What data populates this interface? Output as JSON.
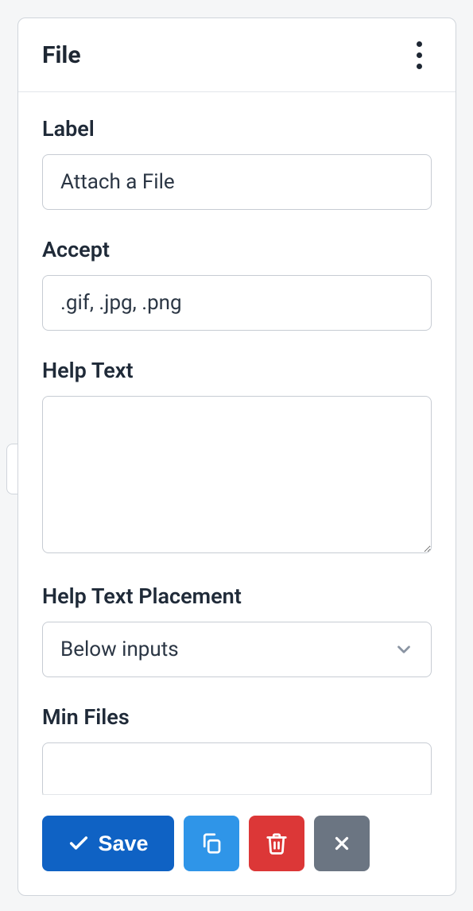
{
  "panel": {
    "title": "File"
  },
  "fields": {
    "label": {
      "label": "Label",
      "value": "Attach a File"
    },
    "accept": {
      "label": "Accept",
      "value": ".gif, .jpg, .png"
    },
    "help_text": {
      "label": "Help Text",
      "value": ""
    },
    "help_text_placement": {
      "label": "Help Text Placement",
      "value": "Below inputs"
    },
    "min_files": {
      "label": "Min Files",
      "value": ""
    }
  },
  "actions": {
    "save": "Save"
  }
}
